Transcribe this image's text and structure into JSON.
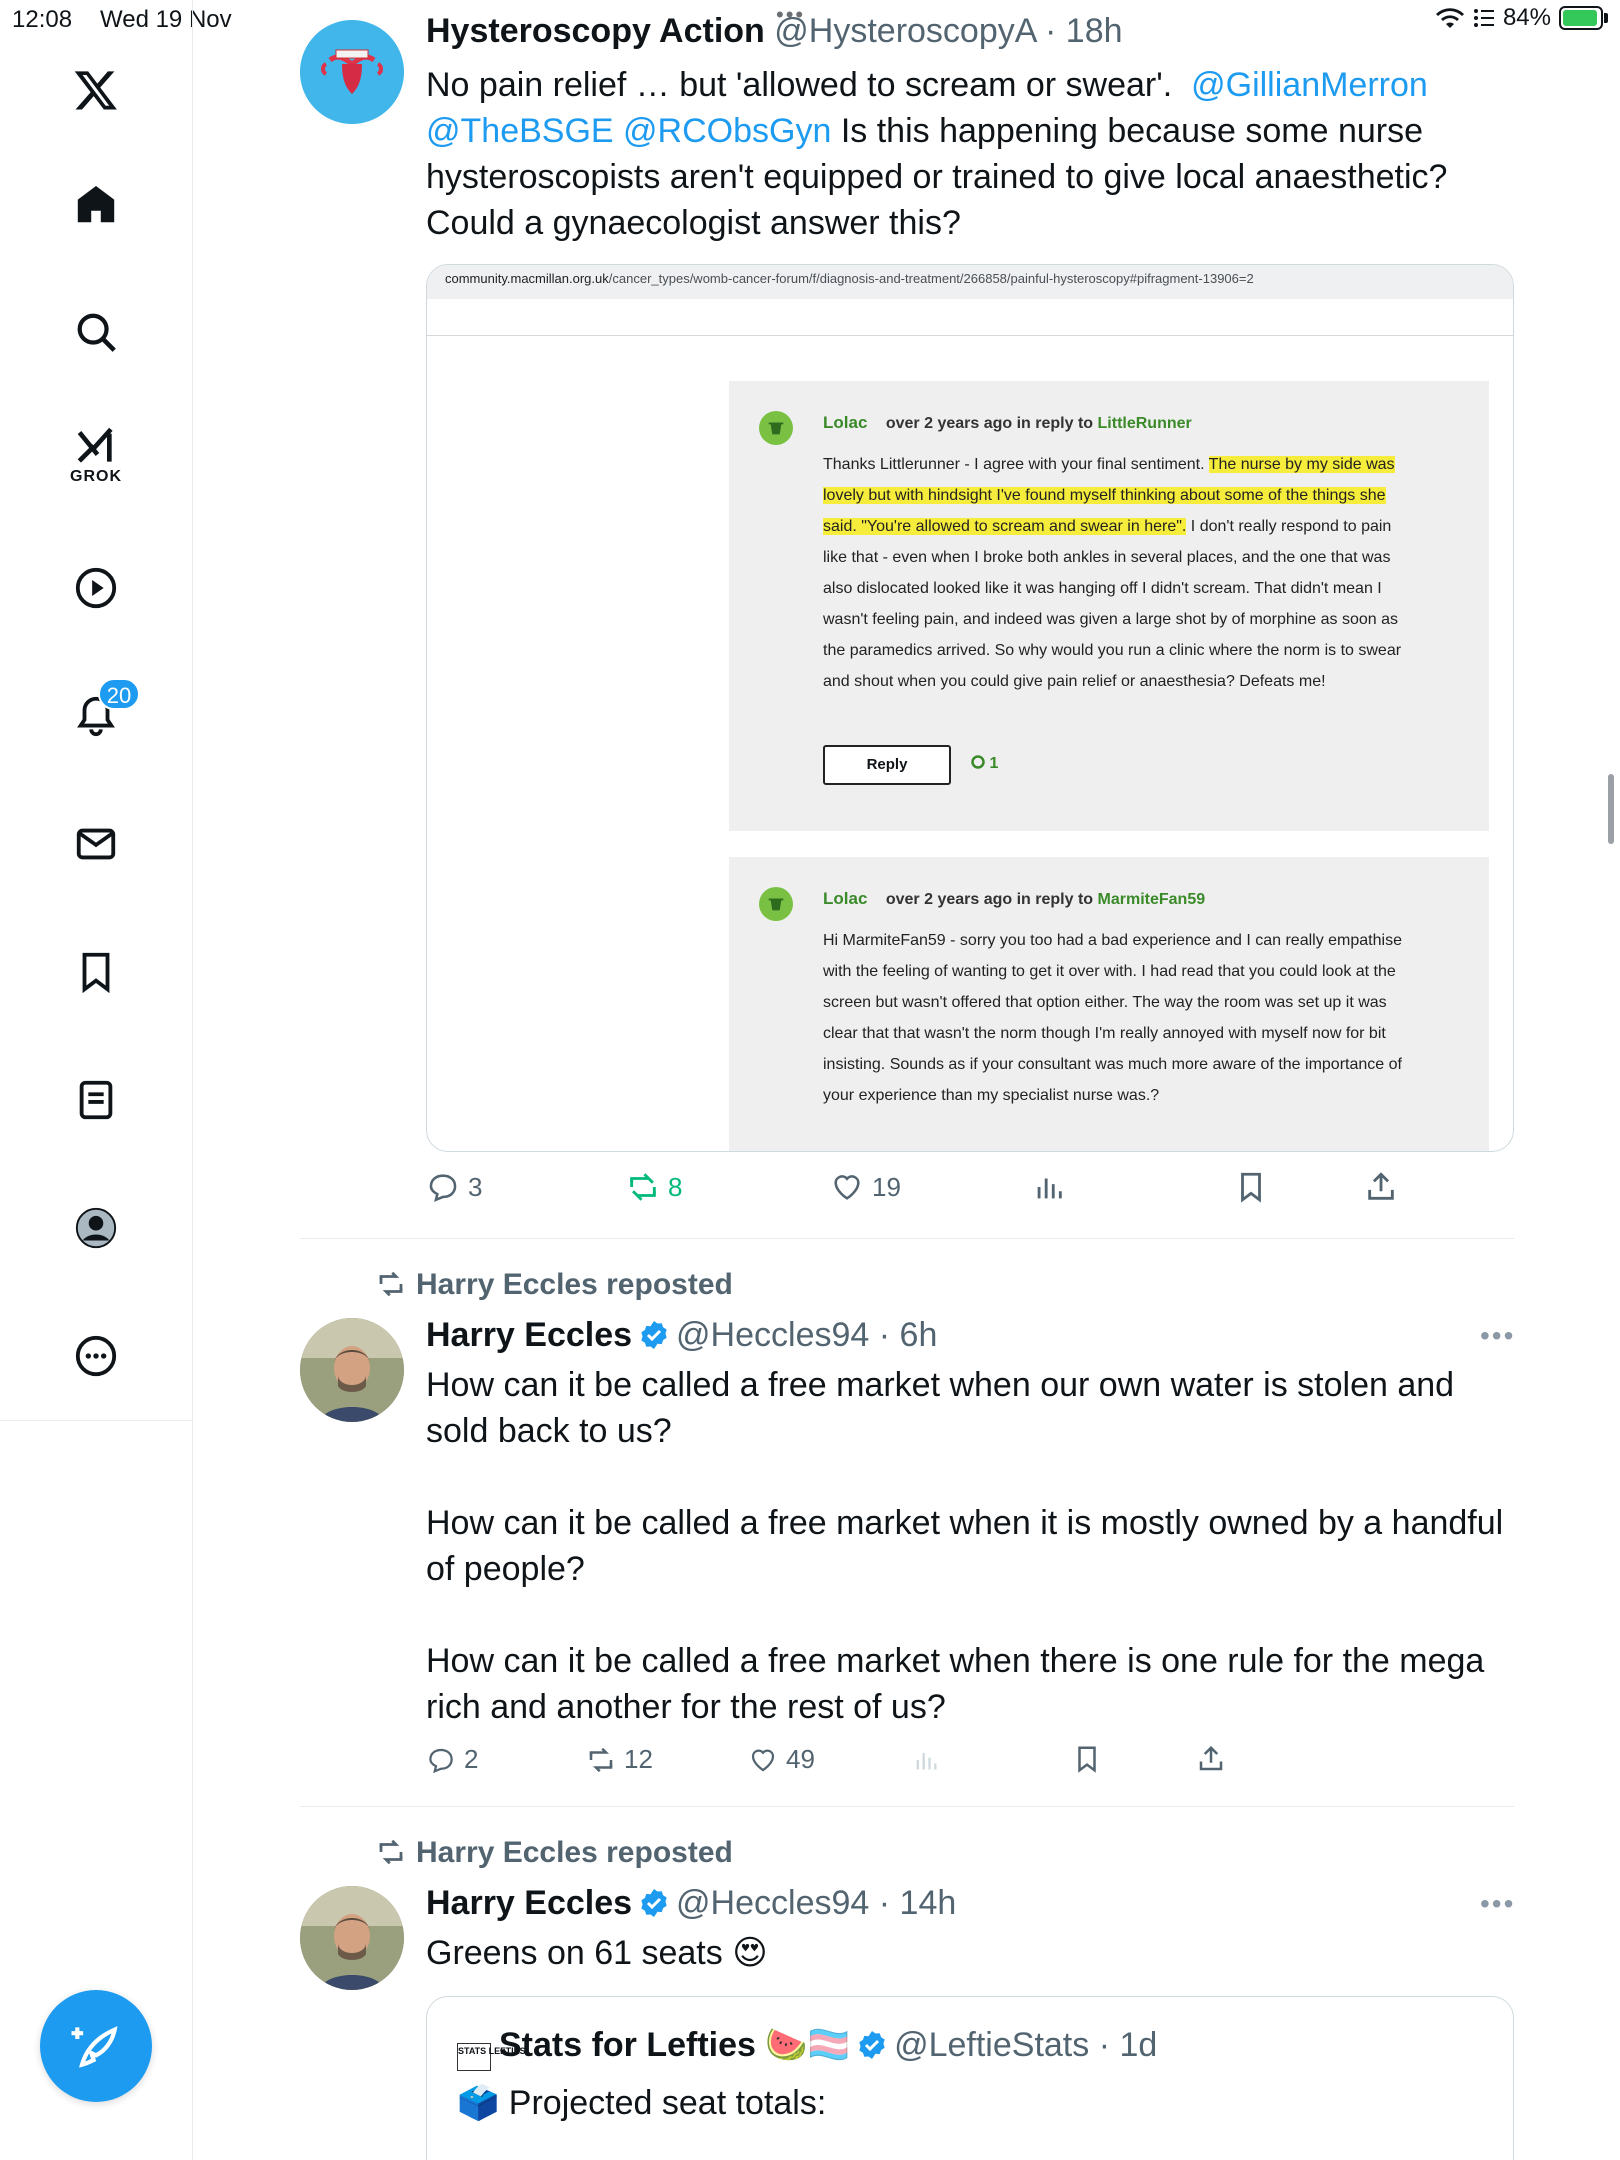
{
  "status": {
    "time": "12:08",
    "date": "Wed 19 Nov",
    "dots": "•••",
    "battery": "84%"
  },
  "sidebar": {
    "grok_label": "GROK",
    "notifications_badge": "20"
  },
  "tweet1": {
    "name": "Hysteroscopy Action",
    "handle": "@HysteroscopyA",
    "time": "· 18h",
    "text_a": "No pain relief … but 'allowed to scream or swear'.",
    "mention1": "@GillianMerron",
    "mention2": "@TheBSGE",
    "mention3": "@RCObsGyn",
    "text_b": "Is this happening because some nurse hysteroscopists aren't equipped or trained to give local anaesthetic? Could a gynaecologist answer this?",
    "card": {
      "url_host": "community.macmillan.org.uk",
      "url_path": "/cancer_types/womb-cancer-forum/f/diagnosis-and-treatment/266858/painful-hysteroscopy#pifragment-13906=2",
      "comment1": {
        "user": "Lolac",
        "meta": "over 2 years ago",
        "in_reply_to": "in reply to",
        "reply_target": "LittleRunner",
        "text_start": "Thanks Littlerunner - I agree with your final sentiment. ",
        "text_highlight": "The nurse by my side was lovely but with hindsight I've found myself thinking about some of the things she said. \"You're allowed to scream and swear in here\".",
        "text_end": " I don't really respond to pain like that - even when I broke both ankles in several places, and the one that was also dislocated looked like it was hanging off I didn't scream.  That didn't mean I wasn't feeling pain, and indeed was given a large shot by of morphine as soon as the paramedics arrived.  So why would you run a clinic where the norm is to swear and shout when you could give pain relief or anaesthesia?  Defeats me!",
        "reply_label": "Reply",
        "likes": "1"
      },
      "comment2": {
        "user": "Lolac",
        "meta": "over 2 years ago",
        "in_reply_to": "in reply to",
        "reply_target": "MarmiteFan59",
        "text": "Hi MarmiteFan59 - sorry you too had a bad experience and I can really empathise with the feeling of wanting to get it over with.  I had read that you could look at the screen but wasn't offered that option either.  The way the room was set up it was clear that that wasn't the norm though I'm really annoyed with myself now for bit insisting.  Sounds as if your consultant was much more aware of the importance of your experience than my specialist nurse was.?"
      }
    },
    "replies": "3",
    "reposts": "8",
    "likes": "19"
  },
  "tweet2": {
    "repost_label": "Harry Eccles reposted",
    "name": "Harry Eccles",
    "handle": "@Heccles94",
    "time": "· 6h",
    "para1": "How can it be called a free market when our own water is stolen and sold back to us?",
    "para2": "How can it be called a free market when it is mostly owned by a handful of people?",
    "para3": "How can it be called a free market when there is one rule for the mega rich and another for the rest of us?",
    "replies": "2",
    "reposts": "12",
    "likes": "49"
  },
  "tweet3": {
    "repost_label": "Harry Eccles reposted",
    "name": "Harry Eccles",
    "handle": "@Heccles94",
    "time": "· 14h",
    "text": "Greens on 61 seats",
    "emoji": "😍",
    "quote": {
      "logo_text": "STATS LEFTIES",
      "name": "Stats for Lefties",
      "name_emoji": "🍉🏳️‍⚧️",
      "handle": "@LeftieStats",
      "time": "· 1d",
      "text_emoji": "🗳️",
      "text": "Projected seat totals:"
    }
  },
  "more_dots": "•••",
  "colors": {
    "accent": "#1d9bf0",
    "repost_active": "#00ba7c",
    "macmillan_green": "#3a8a2a",
    "highlight": "#f6ec3b"
  }
}
